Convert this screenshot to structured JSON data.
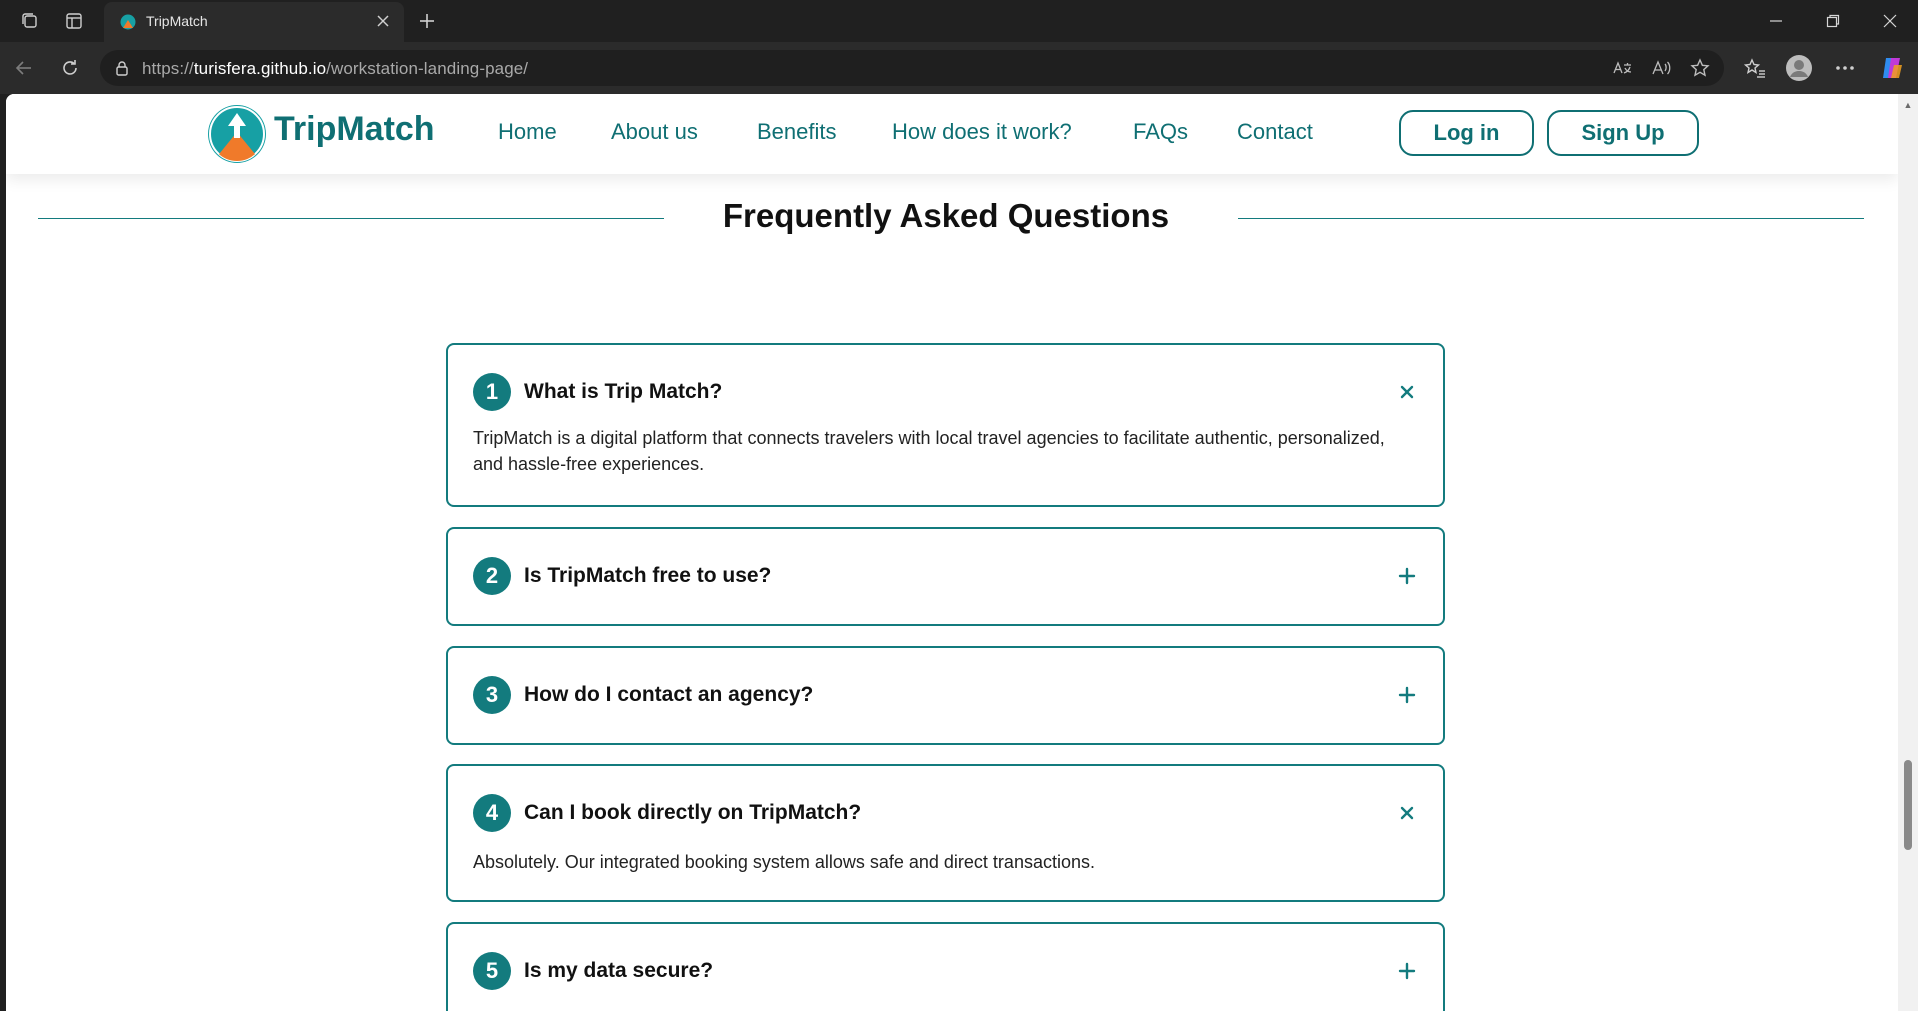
{
  "browser": {
    "tab_title": "TripMatch",
    "url_prefix": "https://",
    "url_host": "turisfera.github.io",
    "url_path": "/workstation-landing-page/"
  },
  "site": {
    "brand": "TripMatch",
    "nav": [
      "Home",
      "About us",
      "Benefits",
      "How does it work?",
      "FAQs",
      "Contact"
    ],
    "login_label": "Log in",
    "signup_label": "Sign Up"
  },
  "faq": {
    "title": "Frequently Asked Questions",
    "items": [
      {
        "number": "1",
        "question": "What is Trip Match?",
        "expanded": true,
        "answer": "TripMatch is a digital platform that connects travelers with local travel agencies to facilitate authentic, personalized, and hassle-free experiences."
      },
      {
        "number": "2",
        "question": "Is TripMatch free to use?",
        "expanded": false,
        "answer": ""
      },
      {
        "number": "3",
        "question": "How do I contact an agency?",
        "expanded": false,
        "answer": ""
      },
      {
        "number": "4",
        "question": "Can I book directly on TripMatch?",
        "expanded": true,
        "answer": "Absolutely. Our integrated booking system allows safe and direct transactions."
      },
      {
        "number": "5",
        "question": "Is my data secure?",
        "expanded": false,
        "answer": ""
      }
    ]
  },
  "colors": {
    "brand_teal": "#137b7e",
    "logo_orange": "#f07a2a"
  },
  "icons": [
    "tab-actions-icon",
    "vertical-tabs-icon",
    "close-icon",
    "new-tab-icon",
    "minimize-icon",
    "restore-icon",
    "back-icon",
    "refresh-icon",
    "lock-icon",
    "translate-icon",
    "read-aloud-icon",
    "favorite-star-icon",
    "favorites-icon",
    "profile-icon",
    "more-icon",
    "copilot-icon",
    "plus-icon",
    "close-x-icon"
  ]
}
